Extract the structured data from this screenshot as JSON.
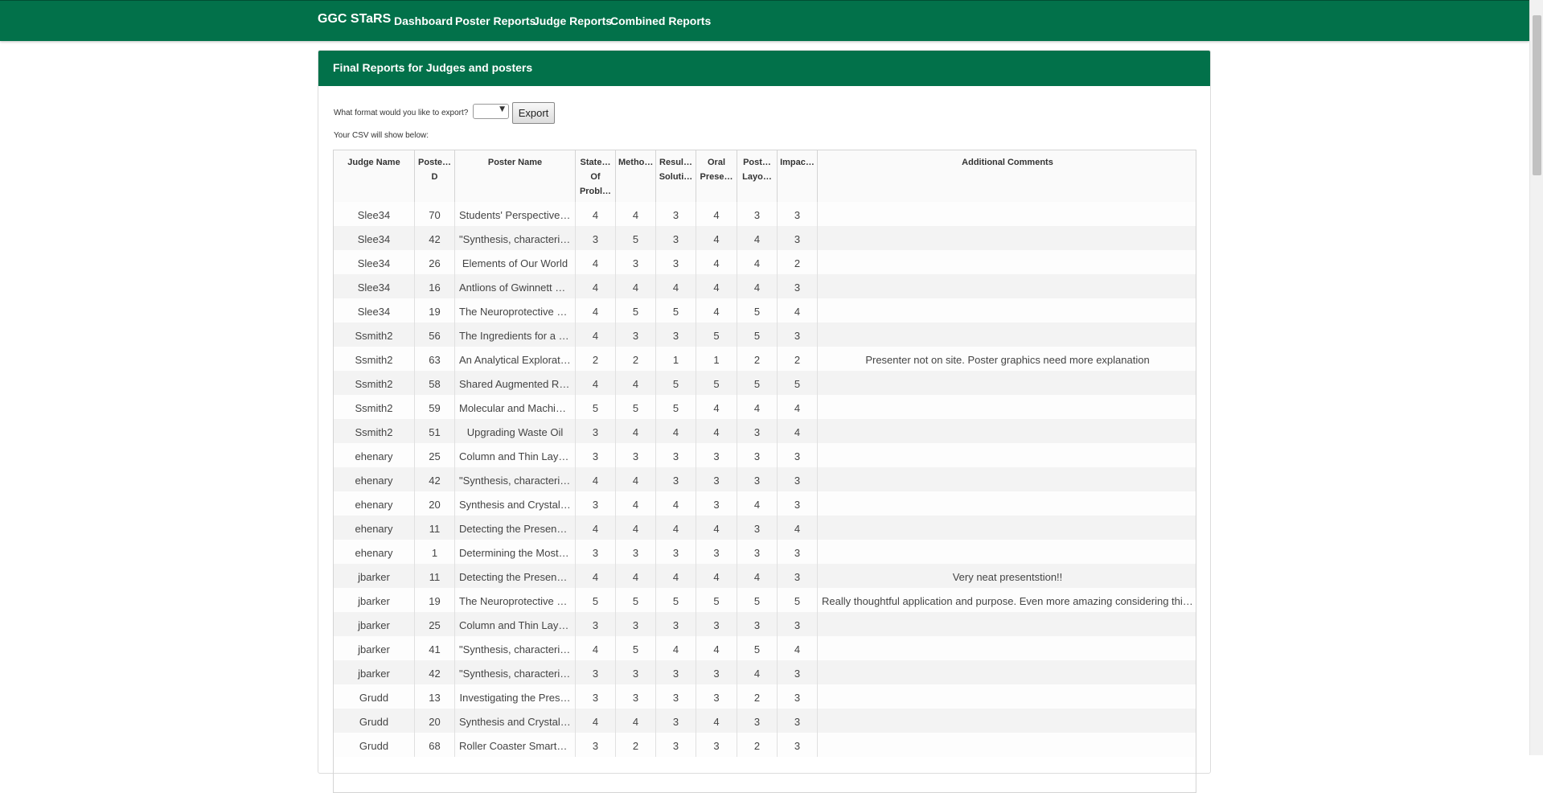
{
  "nav": {
    "brand": "GGC STaRS",
    "links": [
      "Dashboard",
      "Poster Reports",
      "Judge Reports",
      "Combined Reports"
    ]
  },
  "panel": {
    "title": "Final Reports for Judges and posters",
    "export_label": "What format would you like to export?",
    "format_value": "",
    "export_button": "Export",
    "csv_note": "Your CSV will show below:"
  },
  "table": {
    "headers": [
      "Judge Name",
      "Poste… D",
      "Poster Name",
      "State… Of Probl…",
      "Metho…",
      "Resul… Soluti…",
      "Oral Prese…",
      "Post… Layo…",
      "Impac…",
      "Additional Comments"
    ],
    "rows": [
      [
        "Slee34",
        "70",
        "Students' Perspectives …",
        "4",
        "4",
        "3",
        "4",
        "3",
        "3",
        ""
      ],
      [
        "Slee34",
        "42",
        "\"Synthesis, characteriz…",
        "3",
        "5",
        "3",
        "4",
        "4",
        "3",
        ""
      ],
      [
        "Slee34",
        "26",
        "Elements of Our World",
        "4",
        "3",
        "3",
        "4",
        "4",
        "2",
        ""
      ],
      [
        "Slee34",
        "16",
        "Antlions of Gwinnett C…",
        "4",
        "4",
        "4",
        "4",
        "4",
        "3",
        ""
      ],
      [
        "Slee34",
        "19",
        "The Neuroprotective E…",
        "4",
        "5",
        "5",
        "4",
        "5",
        "4",
        ""
      ],
      [
        "Ssmith2",
        "56",
        "The Ingredients for a P…",
        "4",
        "3",
        "3",
        "5",
        "5",
        "3",
        ""
      ],
      [
        "Ssmith2",
        "63",
        "An Analytical Explorati…",
        "2",
        "2",
        "1",
        "1",
        "2",
        "2",
        "Presenter not on site. Poster graphics need more explanation"
      ],
      [
        "Ssmith2",
        "58",
        "Shared Augmented Re…",
        "4",
        "4",
        "5",
        "5",
        "5",
        "5",
        ""
      ],
      [
        "Ssmith2",
        "59",
        "Molecular and Machin…",
        "5",
        "5",
        "5",
        "4",
        "4",
        "4",
        ""
      ],
      [
        "Ssmith2",
        "51",
        "Upgrading Waste Oil",
        "3",
        "4",
        "4",
        "4",
        "3",
        "4",
        ""
      ],
      [
        "ehenary",
        "25",
        "Column and Thin Layer…",
        "3",
        "3",
        "3",
        "3",
        "3",
        "3",
        ""
      ],
      [
        "ehenary",
        "42",
        "\"Synthesis, characteriz…",
        "4",
        "4",
        "3",
        "3",
        "3",
        "3",
        ""
      ],
      [
        "ehenary",
        "20",
        "Synthesis and Crystal S…",
        "3",
        "4",
        "4",
        "3",
        "4",
        "3",
        ""
      ],
      [
        "ehenary",
        "11",
        "Detecting the Presenc…",
        "4",
        "4",
        "4",
        "4",
        "3",
        "4",
        ""
      ],
      [
        "ehenary",
        "1",
        "Determining the Most …",
        "3",
        "3",
        "3",
        "3",
        "3",
        "3",
        ""
      ],
      [
        "jbarker",
        "11",
        "Detecting the Presenc…",
        "4",
        "4",
        "4",
        "4",
        "4",
        "3",
        "Very neat presentstion!!"
      ],
      [
        "jbarker",
        "19",
        "The Neuroprotective E…",
        "5",
        "5",
        "5",
        "5",
        "5",
        "5",
        "Really thoughtful application and purpose. Even more amazing considering this i…"
      ],
      [
        "jbarker",
        "25",
        "Column and Thin Layer…",
        "3",
        "3",
        "3",
        "3",
        "3",
        "3",
        ""
      ],
      [
        "jbarker",
        "41",
        "\"Synthesis, characteriz…",
        "4",
        "5",
        "4",
        "4",
        "5",
        "4",
        ""
      ],
      [
        "jbarker",
        "42",
        "\"Synthesis, characteriz…",
        "3",
        "3",
        "3",
        "3",
        "4",
        "3",
        ""
      ],
      [
        "Grudd",
        "13",
        "Investigating the Pres…",
        "3",
        "3",
        "3",
        "3",
        "2",
        "3",
        ""
      ],
      [
        "Grudd",
        "20",
        "Synthesis and Crystal S…",
        "4",
        "4",
        "3",
        "4",
        "3",
        "3",
        ""
      ],
      [
        "Grudd",
        "68",
        "Roller Coaster Smartp…",
        "3",
        "2",
        "3",
        "3",
        "2",
        "3",
        ""
      ]
    ]
  }
}
